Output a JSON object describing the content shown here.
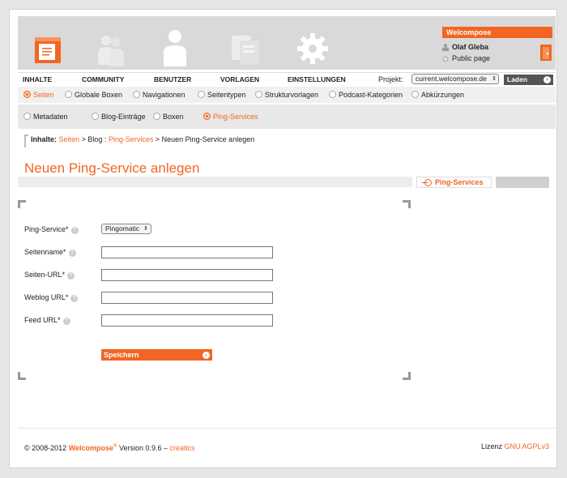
{
  "brand": "Welcompose",
  "user": {
    "name": "Olaf Gleba",
    "public_page": "Public page"
  },
  "main_nav": [
    "INHALTE",
    "COMMUNITY",
    "BENUTZER",
    "VORLAGEN",
    "EINSTELLUNGEN"
  ],
  "project": {
    "label": "Projekt:",
    "selected": "current.welcompose.de",
    "load_button": "Laden"
  },
  "subnav1": [
    {
      "label": "Seiten",
      "active": true
    },
    {
      "label": "Globale Boxen",
      "active": false
    },
    {
      "label": "Navigationen",
      "active": false
    },
    {
      "label": "Seitentypen",
      "active": false
    },
    {
      "label": "Strukturvorlagen",
      "active": false
    },
    {
      "label": "Podcast-Kategorien",
      "active": false
    },
    {
      "label": "Abkürzungen",
      "active": false
    }
  ],
  "subnav2": [
    {
      "label": "Metadaten",
      "active": false
    },
    {
      "label": "Blog-Einträge",
      "active": false
    },
    {
      "label": "Boxen",
      "active": false
    },
    {
      "label": "Ping-Services",
      "active": true
    }
  ],
  "breadcrumb": {
    "prefix": "Inhalte:",
    "seiten": "Seiten",
    "sep1": " > Blog : ",
    "ping": "Ping-Services",
    "sep2": " > ",
    "current": "Neuen Ping-Service anlegen"
  },
  "page_title": "Neuen Ping-Service anlegen",
  "side_tab": "Ping-Services",
  "form": {
    "ping_service_label": "Ping-Service*",
    "ping_service_value": "Pingomatic",
    "fields": [
      {
        "label": "Seitenname*",
        "value": ""
      },
      {
        "label": "Seiten-URL*",
        "value": ""
      },
      {
        "label": "Weblog URL*",
        "value": ""
      },
      {
        "label": "Feed URL*",
        "value": ""
      }
    ],
    "help_glyph": "?",
    "save_button": "Speichern"
  },
  "footer": {
    "copyright": "© 2008-2012 ",
    "brand": "Welcompose",
    "reg": "®",
    "version": " Version 0.9.6 – ",
    "creatics": "creatics",
    "license_label": "Lizenz ",
    "license": "GNU AGPLv3"
  },
  "colors": {
    "accent": "#f26522",
    "header_bg": "#d9d9d9"
  },
  "icons": [
    "logo-book-icon",
    "community-icon",
    "user-icon",
    "templates-icon",
    "settings-gear-icon",
    "logout-door-icon"
  ]
}
